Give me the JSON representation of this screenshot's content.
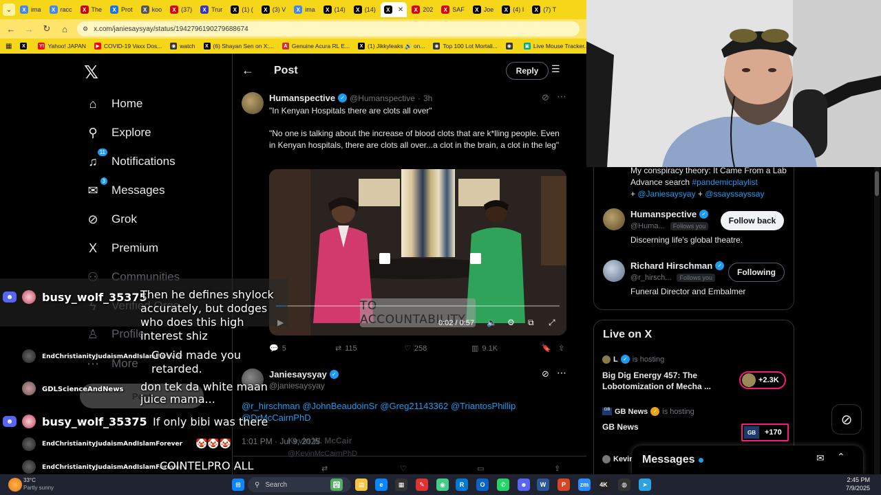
{
  "browser": {
    "tabs": [
      {
        "label": "ima",
        "color": "#4285f4"
      },
      {
        "label": "racc",
        "color": "#4285f4"
      },
      {
        "label": "The",
        "color": "#c00"
      },
      {
        "label": "Prot",
        "color": "#1a73e8"
      },
      {
        "label": "koo",
        "color": "#555"
      },
      {
        "label": "(37)",
        "color": "#d00"
      },
      {
        "label": "Trur",
        "color": "#33c"
      },
      {
        "label": "(1) (",
        "color": "#000"
      },
      {
        "label": "(3) V",
        "color": "#000"
      },
      {
        "label": "ima",
        "color": "#4285f4"
      },
      {
        "label": "(14)",
        "color": "#000"
      },
      {
        "label": "(14)",
        "color": "#000"
      },
      {
        "label": "",
        "color": "#000",
        "active": true
      },
      {
        "label": "202",
        "color": "#d00"
      },
      {
        "label": "SAF",
        "color": "#d00"
      },
      {
        "label": "Joe",
        "color": "#000"
      },
      {
        "label": "(4) I",
        "color": "#000"
      },
      {
        "label": "(7) T",
        "color": "#000"
      }
    ],
    "url": "x.com/janiesaysyay/status/1942796190279688674",
    "bookmarks": [
      {
        "label": "",
        "icon": "X",
        "color": "#000"
      },
      {
        "label": "Yahoo! JAPAN",
        "icon": "Y!",
        "color": "#f00"
      },
      {
        "label": "COVID-19 Vaxx Dos...",
        "icon": "▶",
        "color": "#f00"
      },
      {
        "label": "watch",
        "icon": "◉",
        "color": "#333"
      },
      {
        "label": "(6) Shayan Sen on X:...",
        "icon": "X",
        "color": "#000"
      },
      {
        "label": "Genuine Acura RL E...",
        "icon": "A",
        "color": "#c33"
      },
      {
        "label": "(1) Jikkyleaks 🔊 on...",
        "icon": "X",
        "color": "#000"
      },
      {
        "label": "Top 100 Lot Mortali...",
        "icon": "◉",
        "color": "#333"
      },
      {
        "label": "",
        "icon": "◉",
        "color": "#333"
      },
      {
        "label": "Live Mouse Tracker...",
        "icon": "▣",
        "color": "#0a8"
      }
    ]
  },
  "nav": {
    "items": [
      {
        "label": "Home",
        "icon": "home-icon",
        "glyph": "⌂"
      },
      {
        "label": "Explore",
        "icon": "search-icon",
        "glyph": "⚲"
      },
      {
        "label": "Notifications",
        "icon": "bell-icon",
        "glyph": "♫",
        "badge": "11"
      },
      {
        "label": "Messages",
        "icon": "envelope-icon",
        "glyph": "✉",
        "badge": "3"
      },
      {
        "label": "Grok",
        "icon": "grok-icon",
        "glyph": "⊘"
      },
      {
        "label": "Premium",
        "icon": "x-premium-icon",
        "glyph": "X"
      },
      {
        "label": "Communities",
        "icon": "communities-icon",
        "glyph": "⚇"
      },
      {
        "label": "Verified Orgs",
        "icon": "lightning-icon",
        "glyph": "ϟ"
      },
      {
        "label": "Profile",
        "icon": "person-icon",
        "glyph": "♙"
      },
      {
        "label": "More",
        "icon": "more-icon",
        "glyph": "⋯"
      },
      {
        "label": "Post",
        "icon": "",
        "glyph": ""
      }
    ]
  },
  "post": {
    "header_title": "Post",
    "reply_label": "Reply",
    "tweet": {
      "name": "Humanspective",
      "handle": "@Humanspective",
      "time": "3h",
      "text1": "\"In Kenyan Hospitals there are clots all over\"",
      "text2": "\"No one is talking about the increase of blood clots that are k*lling people. Even in Kenyan hospitals, there are clots all over...a clot in the brain, a clot in the leg\"",
      "video_overlay": "TO ACCOUNTABILITY",
      "video_time": "0:02 / 0:57",
      "video_progress": 0.035,
      "replies": "5",
      "retweets": "115",
      "likes": "258",
      "views": "9.1K"
    },
    "quoted": {
      "name": "Janiesaysyay",
      "handle": "@janiesaysyay",
      "mentions": "@r_hirschman @JohnBeaudoinSr @Greg21143362 @TriantosPhillip @DrMcCairnPhD",
      "author_ghost": "Kevin W. McCair",
      "handle_ghost": "@KevinMcCairnPhD",
      "timestamp": "1:01 PM · Jul 9, 2025"
    }
  },
  "right": {
    "bio_text": "My conspiracy theory: It Came From a Lab Advance search ",
    "bio_tag": "#pandemicplaylist",
    "bio_plus": "+",
    "bio_m1": "@Janiesaysyay",
    "bio_m2": "@ssayssayssay",
    "follows": [
      {
        "name": "Humanspective",
        "handle": "@Huma...",
        "follows_you": "Follows you",
        "bio": "Discerning life's global theatre.",
        "button": "Follow back"
      },
      {
        "name": "Richard Hirschman",
        "handle": "@r_hirsch...",
        "follows_you": "Follows you",
        "bio": "Funeral Director and Embalmer",
        "button": "Following"
      }
    ],
    "live_title": "Live on X",
    "live": [
      {
        "host": "L",
        "hosting": "is hosting",
        "title": "Big Dig Energy 457: The Lobotomization of Mecha ...",
        "count": "+2.3K"
      },
      {
        "host": "GB News",
        "hosting": "is hosting",
        "title": "GB News",
        "count": "+170"
      },
      {
        "host": "Kevin",
        "hosting": "",
        "title": "",
        "count": ""
      }
    ],
    "messages_label": "Messages"
  },
  "chat": [
    {
      "user": "busy_wolf_35375",
      "msg": "Then he defines shylock accurately, but dodges who does this high interest shiz"
    },
    {
      "user": "EndChristianityJudaismAndIslamForever",
      "msg": "Covid made you retarded."
    },
    {
      "user": "GDLScienceAndNews",
      "msg": "don tek da white maan juice mama..."
    },
    {
      "user": "busy_wolf_35375",
      "msg": "If only bibi was there"
    },
    {
      "user": "EndChristianityJudaismAndIslamForever",
      "msg": "🤡🤡🤡"
    },
    {
      "user": "EndChristianityJudaismAndIslamForever",
      "msg": "COINTELPRO ALL DAY."
    }
  ],
  "taskbar": {
    "weather_temp": "33°C",
    "weather_desc": "Partly sunny",
    "search_placeholder": "Search",
    "time": "2:45 PM",
    "date": "7/9/2025"
  },
  "colors": {
    "accent": "#1d9bf0",
    "tabbar": "#f6d618",
    "live_pill": "#f91880"
  }
}
